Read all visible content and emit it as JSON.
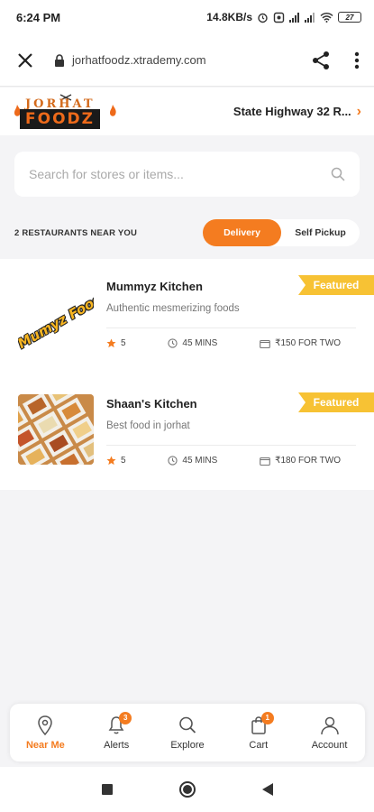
{
  "status_bar": {
    "time": "6:24 PM",
    "speed": "14.8KB/s",
    "battery": "27"
  },
  "browser": {
    "url": "jorhatfoodz.xtrademy.com"
  },
  "header": {
    "logo_top": "JORHAT",
    "logo_bottom": "FOODZ",
    "location": "State Highway 32 R..."
  },
  "search": {
    "placeholder": "Search for stores or items..."
  },
  "filters": {
    "count_label": "2 RESTAURANTS NEAR YOU",
    "delivery": "Delivery",
    "self_pickup": "Self Pickup",
    "active": "Delivery"
  },
  "restaurants": [
    {
      "name": "Mummyz Kitchen",
      "description": "Authentic mesmerizing foods",
      "rating": "5",
      "time": "45 MINS",
      "cost": "₹150 FOR TWO",
      "badge": "Featured",
      "thumb_text": "Mumyz Food"
    },
    {
      "name": "Shaan's Kitchen",
      "description": "Best food in jorhat",
      "rating": "5",
      "time": "45 MINS",
      "cost": "₹180 FOR TWO",
      "badge": "Featured"
    }
  ],
  "bottom_nav": [
    {
      "label": "Near Me",
      "icon": "location-pin-icon",
      "active": true
    },
    {
      "label": "Alerts",
      "icon": "bell-icon",
      "badge": "3"
    },
    {
      "label": "Explore",
      "icon": "search-icon"
    },
    {
      "label": "Cart",
      "icon": "cart-icon",
      "badge": "1"
    },
    {
      "label": "Account",
      "icon": "user-icon"
    }
  ],
  "colors": {
    "accent": "#f47c20",
    "badge": "#f7c234",
    "background": "#f4f4f6"
  }
}
